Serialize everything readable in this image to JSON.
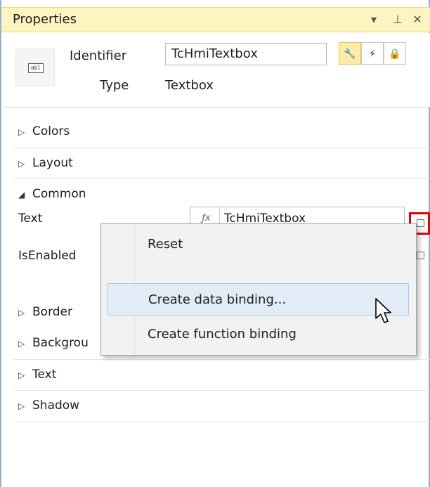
{
  "titlebar": {
    "title": "Properties",
    "dropdown_glyph": "▾",
    "pin_glyph": "⊥",
    "close_glyph": "✕"
  },
  "header": {
    "type_icon_text": "abl",
    "identifier_label": "Identifier",
    "identifier_value": "TcHmiTextbox",
    "type_label": "Type",
    "type_value": "Textbox",
    "mode_buttons": [
      {
        "glyph": "🔧",
        "name": "properties-icon",
        "active": true
      },
      {
        "glyph": "⚡",
        "name": "events-icon",
        "active": false
      },
      {
        "glyph": "🔒",
        "name": "lock-icon",
        "active": false
      }
    ]
  },
  "categories": {
    "colors": "Colors",
    "layout": "Layout",
    "common": "Common",
    "border": "Border",
    "background": "Backgrou",
    "text": "Text",
    "shadow": "Shadow",
    "collapsed_arrow": "▷",
    "expanded_arrow": "◢"
  },
  "common_props": {
    "text_label": "Text",
    "text_value": "TcHmiTextbox",
    "text_fx": "ƒx",
    "isenabled_label": "IsEnabled"
  },
  "context_menu": {
    "items": [
      "Reset",
      "Create data binding...",
      "Create function binding"
    ],
    "hovered_index": 1
  }
}
